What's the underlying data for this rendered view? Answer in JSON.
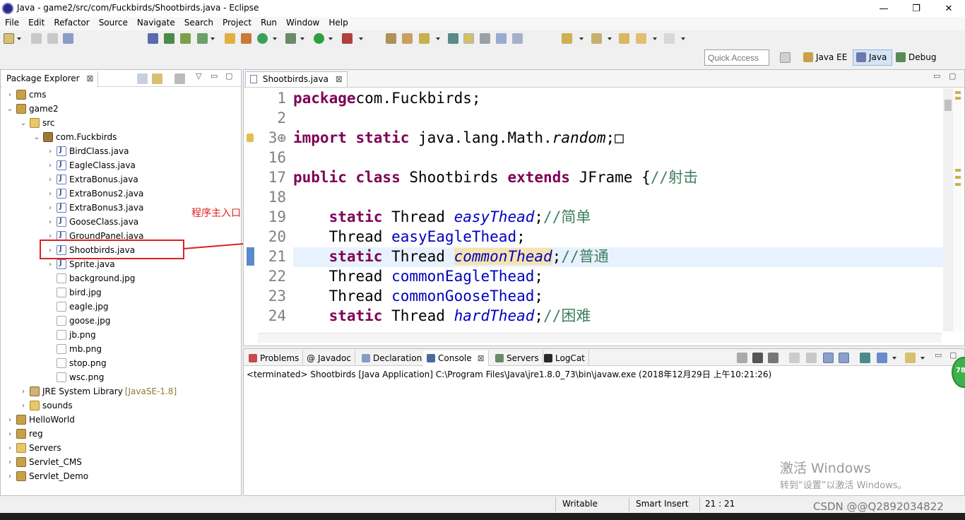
{
  "window": {
    "title": "Java - game2/src/com/Fuckbirds/Shootbirds.java - Eclipse",
    "minimize": "—",
    "maximize": "❐",
    "close": "✕"
  },
  "menu": [
    "File",
    "Edit",
    "Refactor",
    "Source",
    "Navigate",
    "Search",
    "Project",
    "Run",
    "Window",
    "Help"
  ],
  "perspective": {
    "quick_access_placeholder": "Quick Access",
    "java_ee": "Java EE",
    "java": "Java",
    "debug": "Debug"
  },
  "package_explorer": {
    "tab_label": "Package Explorer",
    "items": [
      {
        "label": "cms",
        "depth": 0,
        "twisty": "›",
        "icon": "project"
      },
      {
        "label": "game2",
        "depth": 0,
        "twisty": "⌄",
        "icon": "project"
      },
      {
        "label": "src",
        "depth": 1,
        "twisty": "⌄",
        "icon": "folder"
      },
      {
        "label": "com.Fuckbirds",
        "depth": 2,
        "twisty": "⌄",
        "icon": "package"
      },
      {
        "label": "BirdClass.java",
        "depth": 3,
        "twisty": "›",
        "icon": "java"
      },
      {
        "label": "EagleClass.java",
        "depth": 3,
        "twisty": "›",
        "icon": "java"
      },
      {
        "label": "ExtraBonus.java",
        "depth": 3,
        "twisty": "›",
        "icon": "java"
      },
      {
        "label": "ExtraBonus2.java",
        "depth": 3,
        "twisty": "›",
        "icon": "java"
      },
      {
        "label": "ExtraBonus3.java",
        "depth": 3,
        "twisty": "›",
        "icon": "java"
      },
      {
        "label": "GooseClass.java",
        "depth": 3,
        "twisty": "›",
        "icon": "java"
      },
      {
        "label": "GroundPanel.java",
        "depth": 3,
        "twisty": "›",
        "icon": "java"
      },
      {
        "label": "Shootbirds.java",
        "depth": 3,
        "twisty": "›",
        "icon": "java"
      },
      {
        "label": "Sprite.java",
        "depth": 3,
        "twisty": "›",
        "icon": "java"
      },
      {
        "label": "background.jpg",
        "depth": 3,
        "twisty": "",
        "icon": "image"
      },
      {
        "label": "bird.jpg",
        "depth": 3,
        "twisty": "",
        "icon": "image"
      },
      {
        "label": "eagle.jpg",
        "depth": 3,
        "twisty": "",
        "icon": "image"
      },
      {
        "label": "goose.jpg",
        "depth": 3,
        "twisty": "",
        "icon": "image"
      },
      {
        "label": "jb.png",
        "depth": 3,
        "twisty": "",
        "icon": "image"
      },
      {
        "label": "mb.png",
        "depth": 3,
        "twisty": "",
        "icon": "image"
      },
      {
        "label": "stop.png",
        "depth": 3,
        "twisty": "",
        "icon": "image"
      },
      {
        "label": "wsc.png",
        "depth": 3,
        "twisty": "",
        "icon": "image"
      },
      {
        "label": "JRE System Library",
        "suffix": "[JavaSE-1.8]",
        "depth": 1,
        "twisty": "›",
        "icon": "library"
      },
      {
        "label": "sounds",
        "depth": 1,
        "twisty": "›",
        "icon": "folder"
      },
      {
        "label": "HelloWorld",
        "depth": 0,
        "twisty": "›",
        "icon": "project"
      },
      {
        "label": "reg",
        "depth": 0,
        "twisty": "›",
        "icon": "project"
      },
      {
        "label": "Servers",
        "depth": 0,
        "twisty": "›",
        "icon": "folder"
      },
      {
        "label": "Servlet_CMS",
        "depth": 0,
        "twisty": "›",
        "icon": "project"
      },
      {
        "label": "Servlet_Demo",
        "depth": 0,
        "twisty": "›",
        "icon": "project"
      }
    ]
  },
  "annotation": {
    "label": "程序主入口"
  },
  "editor": {
    "tab_label": "Shootbirds.java",
    "lines": [
      {
        "num": "1",
        "parts": [
          [
            "kw",
            "package"
          ],
          [
            "",
            "com.Fuckbirds;"
          ]
        ]
      },
      {
        "num": "2",
        "parts": []
      },
      {
        "num": "3⊕",
        "parts": [
          [
            "kw",
            "import"
          ],
          [
            "kw",
            " static"
          ],
          [
            "",
            " java.lang.Math."
          ],
          [
            "it",
            "random"
          ],
          [
            "",
            ";□"
          ]
        ]
      },
      {
        "num": "16",
        "parts": []
      },
      {
        "num": "17",
        "parts": [
          [
            "kw",
            "public"
          ],
          [
            "kw",
            " class"
          ],
          [
            "",
            " Shootbirds "
          ],
          [
            "kw",
            "extends"
          ],
          [
            "",
            " JFrame {"
          ],
          [
            "cmt",
            "//射击"
          ]
        ]
      },
      {
        "num": "18",
        "parts": []
      },
      {
        "num": "19",
        "parts": [
          [
            "",
            "    "
          ],
          [
            "kw",
            "static"
          ],
          [
            "",
            " Thread "
          ],
          [
            "ifld",
            "easyThead"
          ],
          [
            "",
            ";"
          ],
          [
            "cmt",
            "//简单"
          ]
        ]
      },
      {
        "num": "20",
        "parts": [
          [
            "",
            "    Thread "
          ],
          [
            "fld",
            "easyEagleThead"
          ],
          [
            "",
            ";"
          ]
        ]
      },
      {
        "num": "21",
        "parts": [
          [
            "",
            "    "
          ],
          [
            "kw",
            "static"
          ],
          [
            "",
            " Thread "
          ],
          [
            "ifld-occ",
            "commonThead"
          ],
          [
            "",
            ";"
          ],
          [
            "cmt",
            "//普通"
          ]
        ]
      },
      {
        "num": "22",
        "parts": [
          [
            "",
            "    Thread "
          ],
          [
            "fld",
            "commonEagleThead"
          ],
          [
            "",
            ";"
          ]
        ]
      },
      {
        "num": "23",
        "parts": [
          [
            "",
            "    Thread "
          ],
          [
            "fld",
            "commonGooseThead"
          ],
          [
            "",
            ";"
          ]
        ]
      },
      {
        "num": "24",
        "parts": [
          [
            "",
            "    "
          ],
          [
            "kw",
            "static"
          ],
          [
            "",
            " Thread "
          ],
          [
            "ifld",
            "hardThead"
          ],
          [
            "",
            ";"
          ],
          [
            "cmt",
            "//困难"
          ]
        ]
      }
    ]
  },
  "console": {
    "tabs": [
      "Problems",
      "Javadoc",
      "Declaration",
      "Console",
      "Servers",
      "LogCat"
    ],
    "status": "<terminated> Shootbirds [Java Application] C:\\Program Files\\Java\\jre1.8.0_73\\bin\\javaw.exe (2018年12月29日 上午10:21:26)"
  },
  "statusbar": {
    "writable": "Writable",
    "insert_mode": "Smart Insert",
    "position": "21 : 21"
  },
  "overlay": {
    "activate_title": "激活 Windows",
    "activate_sub": "转到“设置”以激活 Windows。",
    "csdn": "CSDN @@Q2892034822",
    "badge": "78"
  }
}
